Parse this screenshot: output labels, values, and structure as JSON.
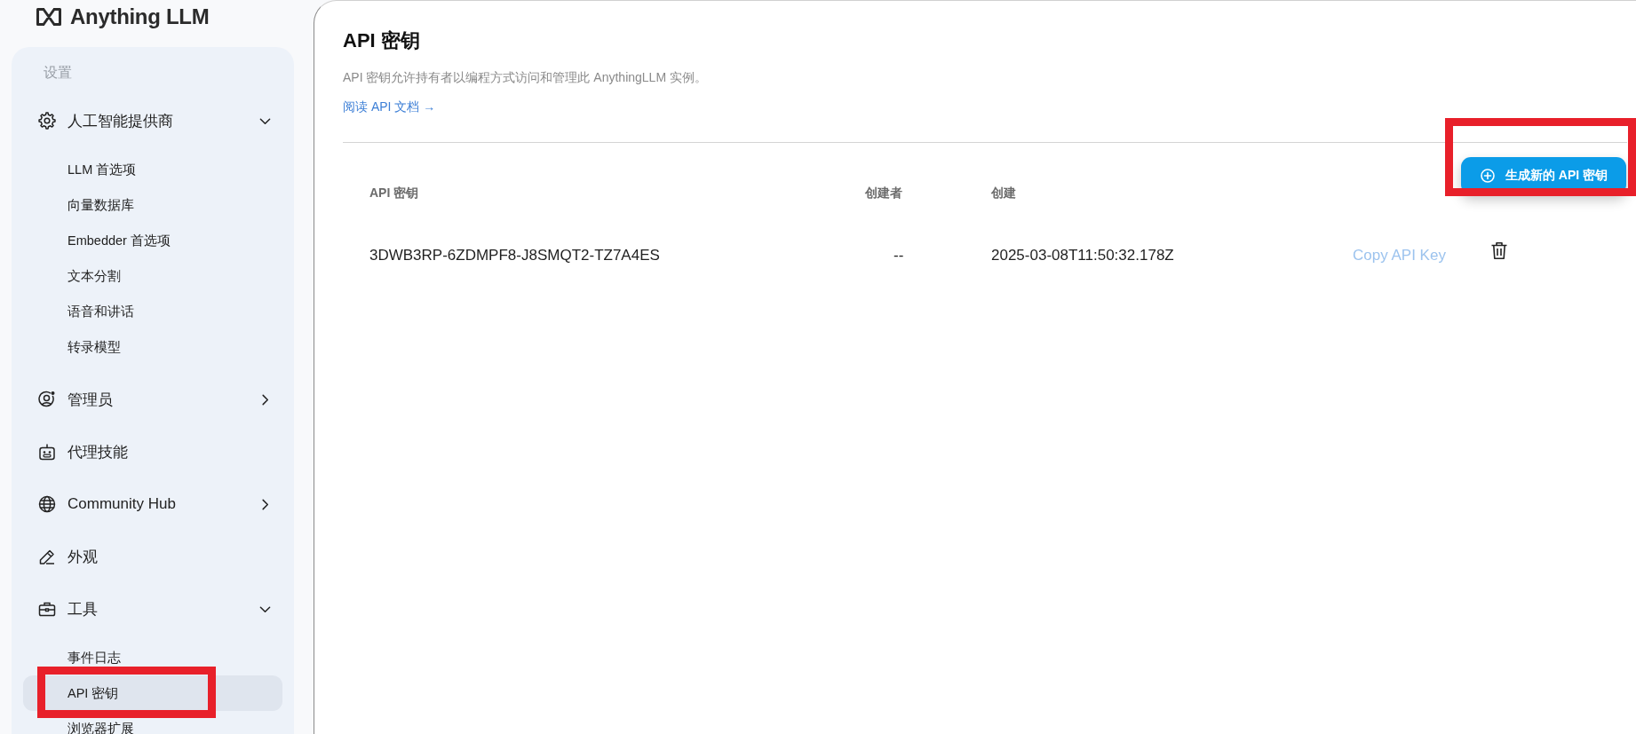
{
  "brand": {
    "name": "Anything LLM"
  },
  "sidebar": {
    "heading": "设置",
    "items": [
      {
        "kind": "group",
        "label": "人工智能提供商",
        "expanded": true,
        "children": [
          {
            "label": "LLM 首选项",
            "selected": false,
            "highlighted": false
          },
          {
            "label": "向量数据库",
            "selected": false,
            "highlighted": false
          },
          {
            "label": "Embedder 首选项",
            "selected": false,
            "highlighted": false
          },
          {
            "label": "文本分割",
            "selected": false,
            "highlighted": false
          },
          {
            "label": "语音和讲话",
            "selected": false,
            "highlighted": false
          },
          {
            "label": "转录模型",
            "selected": false,
            "highlighted": false
          }
        ]
      },
      {
        "kind": "group",
        "label": "管理员",
        "expanded": false
      },
      {
        "kind": "link",
        "label": "代理技能"
      },
      {
        "kind": "group",
        "label": "Community Hub",
        "expanded": false
      },
      {
        "kind": "link",
        "label": "外观"
      },
      {
        "kind": "group",
        "label": "工具",
        "expanded": true,
        "children": [
          {
            "label": "事件日志",
            "selected": false,
            "highlighted": false
          },
          {
            "label": "API 密钥",
            "selected": true,
            "highlighted": true
          },
          {
            "label": "浏览器扩展",
            "selected": false,
            "highlighted": false
          }
        ]
      }
    ]
  },
  "page": {
    "title": "API 密钥",
    "description": "API 密钥允许持有者以编程方式访问和管理此 AnythingLLM 实例。",
    "docs_link": "阅读 API 文档 →",
    "generate_button": {
      "label": "生成新的 API 密钥",
      "highlighted": true
    },
    "table": {
      "columns": [
        "API 密钥",
        "创建者",
        "创建"
      ],
      "rows": [
        {
          "key": "3DWB3RP-6ZDMPF8-J8SMQT2-TZ7A4ES",
          "created_by": "--",
          "created": "2025-03-08T11:50:32.178Z",
          "copy_link": "Copy API Key"
        }
      ]
    }
  }
}
